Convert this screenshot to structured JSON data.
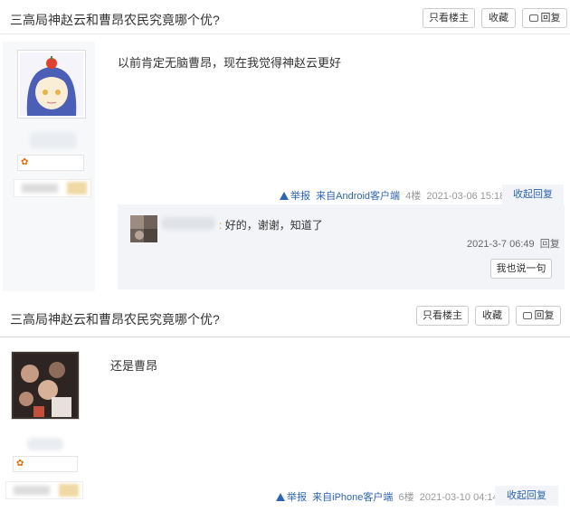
{
  "thread_title": "三高局神赵云和曹昂农民究竟哪个优?",
  "buttons": {
    "only_op": "只看楼主",
    "favorite": "收藏",
    "reply": "回复"
  },
  "posts": [
    {
      "content": "以前肯定无脑曹昂，现在我觉得神赵云更好",
      "report": "举报",
      "source": "来自Android客户端",
      "floor": "4楼",
      "time": "2021-03-06 15:18",
      "collapse": "收起回复",
      "replies": [
        {
          "text": "好的，谢谢，知道了",
          "time": "2021-3-7 06:49",
          "reply_label": "回复"
        }
      ],
      "say_button": "我也说一句"
    },
    {
      "content": "还是曹昂",
      "report": "举报",
      "source": "来自iPhone客户端",
      "floor": "6楼",
      "time": "2021-03-10 04:14",
      "collapse": "收起回复"
    }
  ]
}
